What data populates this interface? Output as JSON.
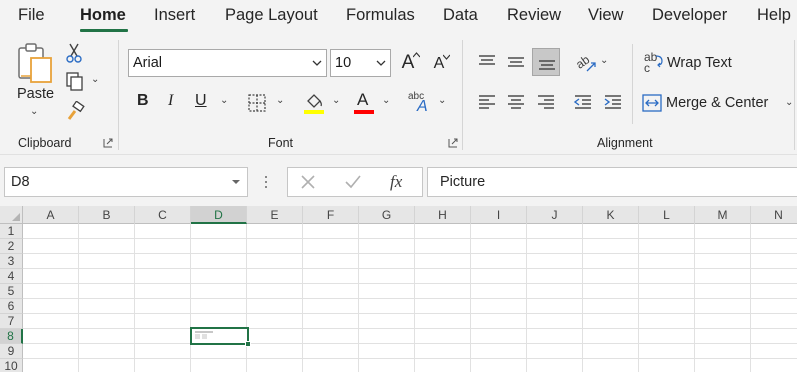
{
  "menu": {
    "tabs": [
      "File",
      "Home",
      "Insert",
      "Page Layout",
      "Formulas",
      "Data",
      "Review",
      "View",
      "Developer",
      "Help"
    ],
    "active": "Home"
  },
  "ribbon": {
    "clipboard": {
      "label": "Clipboard",
      "paste_label": "Paste"
    },
    "font": {
      "label": "Font",
      "font_name": "Arial",
      "font_size": "10",
      "bold": "B",
      "italic": "I",
      "underline": "U",
      "font_color_letter": "A",
      "grow_letter": "A",
      "shrink_letter": "A",
      "abc": "abc",
      "abc_a": "A"
    },
    "alignment": {
      "label": "Alignment",
      "wrap_text": "Wrap Text",
      "merge_center": "Merge & Center",
      "ab": "ab",
      "c": "c"
    }
  },
  "formula_bar": {
    "name_box": "D8",
    "fx": "fx",
    "formula": "Picture"
  },
  "grid": {
    "columns": [
      "A",
      "B",
      "C",
      "D",
      "E",
      "F",
      "G",
      "H",
      "I",
      "J",
      "K",
      "L",
      "M",
      "N"
    ],
    "rows": [
      "1",
      "2",
      "3",
      "4",
      "5",
      "6",
      "7",
      "8",
      "9",
      "10"
    ],
    "selected_column": "D",
    "selected_row": "8"
  },
  "colors": {
    "accent": "#217346",
    "highlight": "#ffff00",
    "font_color": "#ff0000"
  }
}
